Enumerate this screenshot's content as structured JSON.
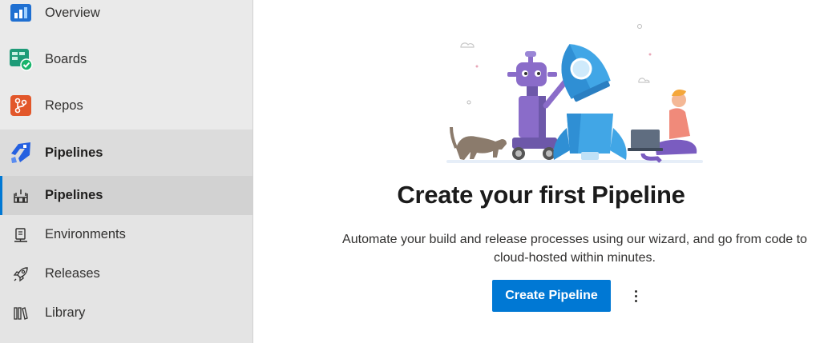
{
  "sidebar": {
    "sections": [
      {
        "label": "Overview",
        "icon": "overview-icon"
      },
      {
        "label": "Boards",
        "icon": "boards-icon"
      },
      {
        "label": "Repos",
        "icon": "repos-icon"
      },
      {
        "label": "Pipelines",
        "icon": "pipelines-icon"
      }
    ],
    "sub_items": [
      {
        "label": "Pipelines",
        "icon": "pipelines-sub-icon"
      },
      {
        "label": "Environments",
        "icon": "environments-icon"
      },
      {
        "label": "Releases",
        "icon": "releases-rocket-icon"
      },
      {
        "label": "Library",
        "icon": "library-icon"
      }
    ]
  },
  "main": {
    "title": "Create your first Pipeline",
    "description": "Automate your build and release processes using our wizard, and go from code to cloud-hosted within minutes.",
    "cta_label": "Create Pipeline",
    "more_icon": "more-options-icon"
  },
  "colors": {
    "accent": "#0078d4",
    "sidebar_bg": "#eaeaea",
    "selected_bg": "#d2d2d2"
  }
}
